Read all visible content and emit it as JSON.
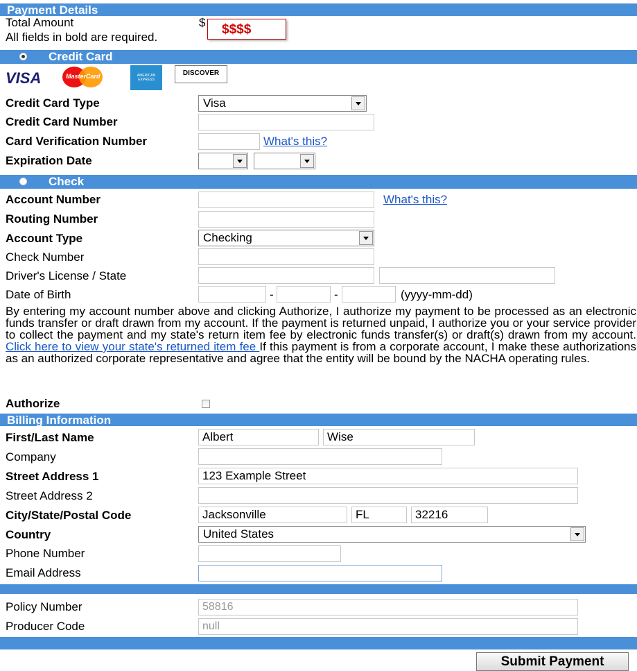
{
  "payment": {
    "section_title": "Payment Details",
    "total_label": "Total Amount",
    "currency_symbol": "$",
    "total_value": "$$$$",
    "required_note": "All fields in bold are required."
  },
  "credit_card": {
    "section_title": "Credit Card",
    "card_logos": [
      "VISA",
      "MasterCard",
      "AMERICAN EXPRESS",
      "DISCOVER"
    ],
    "type_label": "Credit Card Type",
    "type_value": "Visa",
    "number_label": "Credit Card Number",
    "cvv_label": "Card Verification Number",
    "cvv_help": "What's this?",
    "expiration_label": "Expiration Date"
  },
  "check": {
    "section_title": "Check",
    "account_number_label": "Account Number",
    "account_help": "What's this?",
    "routing_label": "Routing Number",
    "account_type_label": "Account Type",
    "account_type_value": "Checking",
    "check_number_label": "Check Number",
    "license_label": "Driver's License / State",
    "dob_label": "Date of Birth",
    "dob_sep": "-",
    "dob_format": "(yyyy-mm-dd)",
    "terms_text_1": "By entering my account number above and clicking Authorize, I authorize my payment to be processed as an electronic funds transfer or draft drawn from my account. If the payment is returned unpaid, I authorize you or your service provider to collect the payment and my state's return item fee by electronic funds transfer(s) or draft(s) drawn from my account. ",
    "terms_link": "Click here to view your state's returned item fee ",
    "terms_text_2": "If this payment is from a corporate account, I make these authorizations as an authorized corporate representative and agree that the entity will be bound by the NACHA operating rules.",
    "authorize_label": "Authorize"
  },
  "billing": {
    "section_title": "Billing Information",
    "name_label": "First/Last Name",
    "first_name": "Albert",
    "last_name": "Wise",
    "company_label": "Company",
    "street1_label": "Street Address 1",
    "street1": "123 Example Street",
    "street2_label": "Street Address 2",
    "city_label": "City/State/Postal Code",
    "city": "Jacksonville",
    "state": "FL",
    "postal": "32216",
    "country_label": "Country",
    "country": "United States",
    "phone_label": "Phone Number",
    "email_label": "Email Address"
  },
  "policy": {
    "policy_label": "Policy Number",
    "policy_value": "58816",
    "producer_label": "Producer Code",
    "producer_value": "null"
  },
  "submit_label": "Submit Payment",
  "colors": {
    "header_bar": "#4a90d9",
    "link": "#1a56c6",
    "total_amount": "#d40000"
  }
}
